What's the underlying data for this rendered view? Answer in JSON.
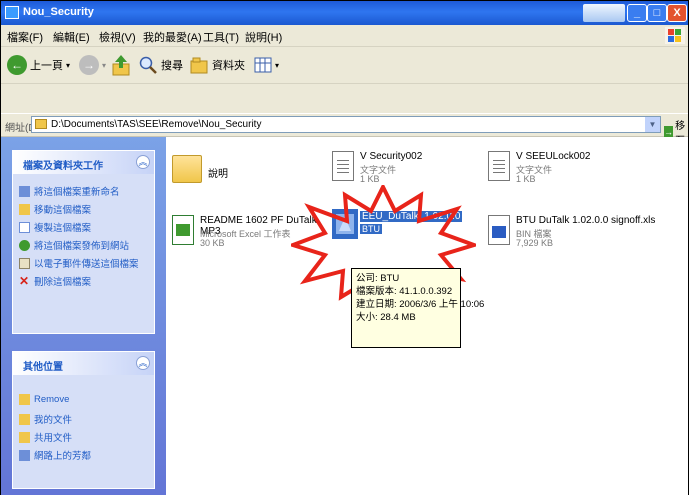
{
  "window": {
    "title": "Nou_Security",
    "buttons": {
      "minimize": "_",
      "maximize": "□",
      "close": "X"
    }
  },
  "menu": {
    "items": [
      "檔案(F)",
      "編輯(E)",
      "檢視(V)",
      "我的最愛(A)",
      "工具(T)",
      "說明(H)"
    ]
  },
  "toolbar": {
    "back_label": "上一頁",
    "forward_label": "",
    "search_label": "搜尋",
    "folders_label": "資料夾"
  },
  "address": {
    "label": "網址(D)",
    "path": "D:\\Documents\\TAS\\SEE\\Remove\\Nou_Security",
    "go_label": "移至"
  },
  "sidebar": {
    "tasks_title": "檔案及資料夾工作",
    "tasks": [
      "將這個檔案重新命名",
      "移動這個檔案",
      "複製這個檔案",
      "將這個檔案發佈到網站",
      "以電子郵件傳送這個檔案",
      "刪除這個檔案"
    ],
    "other_title": "其他位置",
    "places": [
      "Remove",
      "我的文件",
      "共用文件",
      "網路上的芳鄰"
    ]
  },
  "files": [
    {
      "name": "說明",
      "type": "",
      "size": ""
    },
    {
      "name": "V Security002",
      "type": "文字文件",
      "size": "1 KB"
    },
    {
      "name": "V SEEULock002",
      "type": "文字文件",
      "size": "1 KB"
    },
    {
      "name": "README 1602 PF DuTalk MP3",
      "type": "Microsoft Excel 工作表",
      "size": "30 KB"
    },
    {
      "name": "EEU_DuTalk_1.02.0.0",
      "type": "BTU",
      "size": ""
    },
    {
      "name": "BTU DuTalk 1.02.0.0 signoff.xls",
      "type": "BIN 檔案",
      "size": "7,929 KB"
    }
  ],
  "tooltip": {
    "lines": [
      "公司: BTU",
      "檔案版本: 41.1.0.0.392",
      "建立日期: 2006/3/6 上午 10:06",
      "大小: 28.4 MB"
    ]
  },
  "colors": {
    "title_blue": "#2f76f0",
    "panel_text": "#215dc6",
    "selection": "#316ac5",
    "burst_red": "#e8241a"
  }
}
